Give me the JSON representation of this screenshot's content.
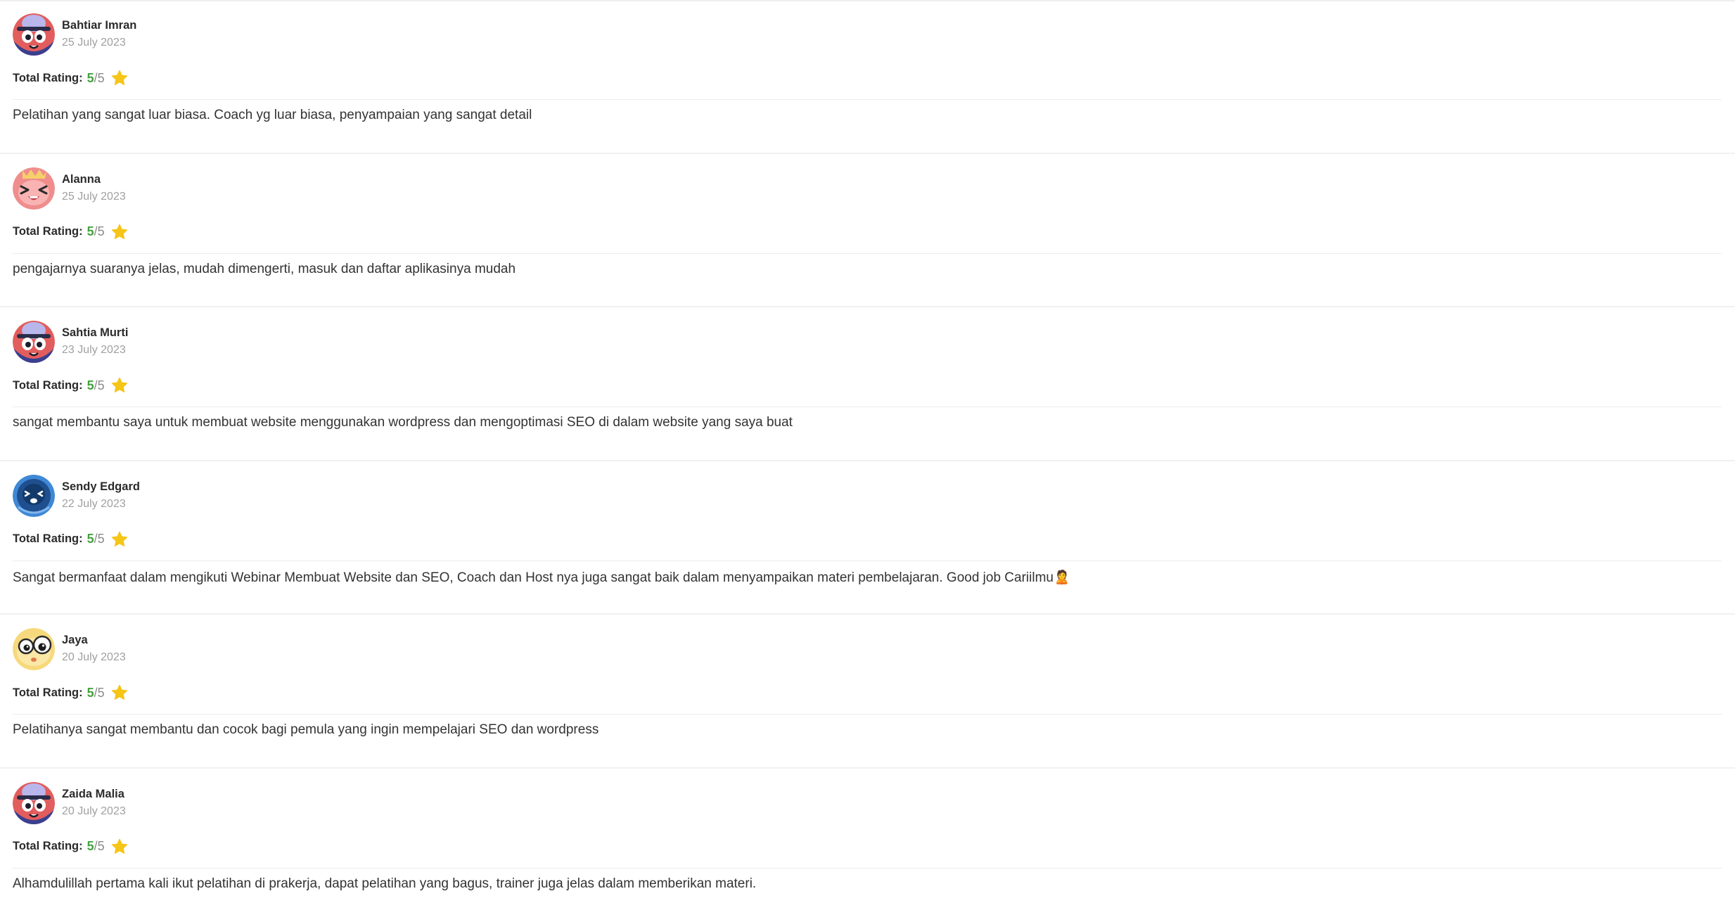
{
  "reviews": [
    {
      "name": "Bahtiar Imran",
      "date": "25 July 2023",
      "rating_label": "Total Rating:",
      "rating": "5",
      "rating_separator": "/",
      "rating_max": "5",
      "text": "Pelatihan yang sangat luar biasa. Coach yg luar biasa, penyampaian yang sangat detail",
      "avatar": "purple-cap-creature-avatar"
    },
    {
      "name": "Alanna",
      "date": "25 July 2023",
      "rating_label": "Total Rating:",
      "rating": "5",
      "rating_separator": "/",
      "rating_max": "5",
      "text": "pengajarnya suaranya jelas, mudah dimengerti, masuk dan daftar aplikasinya mudah",
      "avatar": "pink-laughing-avatar"
    },
    {
      "name": "Sahtia Murti",
      "date": "23 July 2023",
      "rating_label": "Total Rating:",
      "rating": "5",
      "rating_separator": "/",
      "rating_max": "5",
      "text": "sangat membantu saya untuk membuat website menggunakan wordpress dan mengoptimasi SEO di dalam website yang saya buat",
      "avatar": "purple-cap-creature-avatar"
    },
    {
      "name": "Sendy Edgard",
      "date": "22 July 2023",
      "rating_label": "Total Rating:",
      "rating": "5",
      "rating_separator": "/",
      "rating_max": "5",
      "text": "Sangat bermanfaat dalam mengikuti Webinar Membuat Website dan SEO, Coach dan Host nya juga sangat baik dalam menyampaikan materi pembelajaran. Good job Cariilmu",
      "text_emoji": "🙎",
      "avatar": "blue-orb-avatar"
    },
    {
      "name": "Jaya",
      "date": "20 July 2023",
      "rating_label": "Total Rating:",
      "rating": "5",
      "rating_separator": "/",
      "rating_max": "5",
      "text": "Pelatihanya sangat membantu dan cocok bagi pemula yang ingin mempelajari SEO dan wordpress",
      "avatar": "yellow-big-eyes-avatar"
    },
    {
      "name": "Zaida Malia",
      "date": "20 July 2023",
      "rating_label": "Total Rating:",
      "rating": "5",
      "rating_separator": "/",
      "rating_max": "5",
      "text": "Alhamdulillah pertama kali ikut pelatihan di prakerja, dapat pelatihan yang bagus, trainer juga jelas dalam memberikan materi.",
      "avatar": "purple-cap-creature-avatar"
    }
  ],
  "colors": {
    "rating_value": "#43a33b",
    "star": "#f5c518",
    "date": "#a0a0a0",
    "divider": "#ececec"
  },
  "icons": {
    "rating": "star-icon"
  }
}
